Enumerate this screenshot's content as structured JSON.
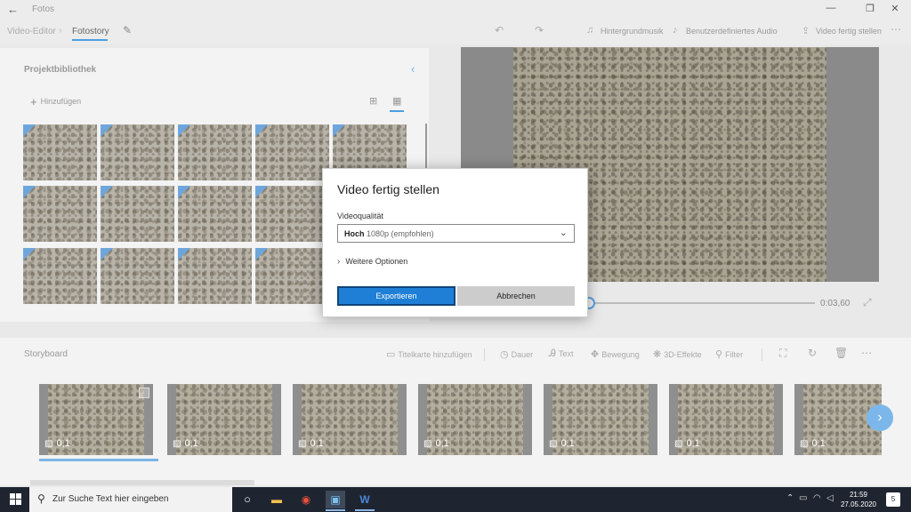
{
  "window": {
    "title": "Fotos"
  },
  "nav": {
    "crumb_parent": "Video-Editor",
    "crumb_current": "Fotostory",
    "toolbar": {
      "music": "Hintergrundmusik",
      "custom_audio": "Benutzerdefiniertes Audio",
      "finish_video": "Video fertig stellen"
    }
  },
  "library": {
    "title": "Projektbibliothek",
    "add_label": "Hinzufügen"
  },
  "preview": {
    "time": "0:03,60",
    "progress": 0.0
  },
  "storyboard": {
    "title": "Storyboard",
    "tools": {
      "title_card": "Titelkarte hinzufügen",
      "duration": "Dauer",
      "text": "Text",
      "motion": "Bewegung",
      "effects3d": "3D-Effekte",
      "filter": "Filter"
    },
    "clips": [
      {
        "label": "0,1"
      },
      {
        "label": "0,1"
      },
      {
        "label": "0,1"
      },
      {
        "label": "0,1"
      },
      {
        "label": "0,1"
      },
      {
        "label": "0,1"
      },
      {
        "label": "0,1"
      }
    ]
  },
  "dialog": {
    "title": "Video fertig stellen",
    "quality_label": "Videoqualität",
    "quality_value_main": "Hoch",
    "quality_value_sub": "1080p (empfohlen)",
    "more_options": "Weitere Optionen",
    "export_button": "Exportieren",
    "cancel_button": "Abbrechen"
  },
  "taskbar": {
    "search_placeholder": "Zur Suche Text hier eingeben",
    "time": "21:59",
    "date": "27.05.2020",
    "notification_count": "5"
  },
  "colors": {
    "accent": "#1f7fd6",
    "taskbar": "#1f2530"
  }
}
